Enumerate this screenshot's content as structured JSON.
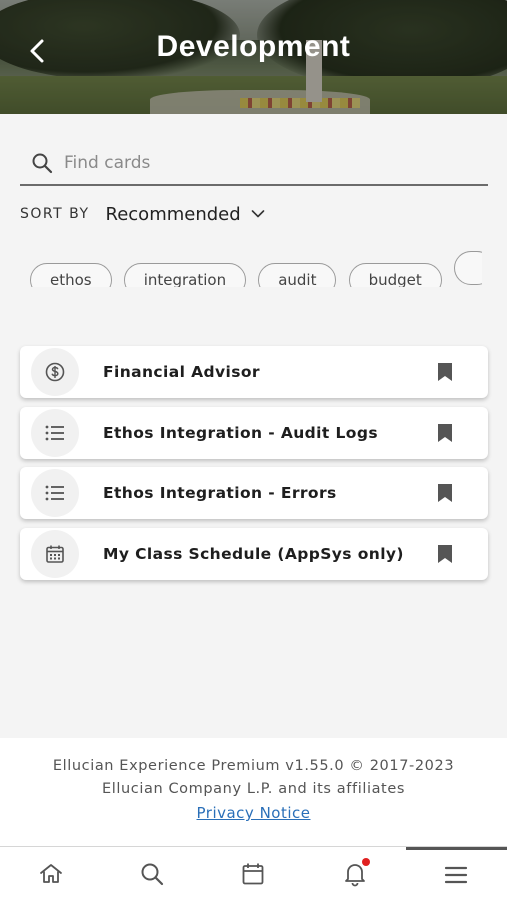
{
  "header": {
    "title": "Development",
    "back_icon": "chevron-left-icon"
  },
  "search": {
    "placeholder": "Find cards",
    "value": "",
    "icon": "search-icon"
  },
  "sort": {
    "label": "SORT BY",
    "value": "Recommended",
    "icon": "chevron-down-icon"
  },
  "chips": [
    {
      "label": "ethos"
    },
    {
      "label": "integration"
    },
    {
      "label": "audit"
    },
    {
      "label": "budget"
    }
  ],
  "cards": [
    {
      "title": "Financial Advisor",
      "icon": "dollar-circle-icon"
    },
    {
      "title": "Ethos Integration - Audit Logs",
      "icon": "list-icon"
    },
    {
      "title": "Ethos Integration - Errors",
      "icon": "list-icon"
    },
    {
      "title": "My Class Schedule (AppSys only)",
      "icon": "calendar-icon"
    }
  ],
  "footer": {
    "line1": "Ellucian Experience Premium v1.55.0 © 2017-2023",
    "line2": "Ellucian Company L.P. and its affiliates",
    "privacy_link": "Privacy Notice"
  },
  "nav": {
    "items": [
      "home-icon",
      "search-icon",
      "calendar-icon",
      "bell-icon",
      "menu-icon"
    ],
    "active": "menu-icon",
    "notification": true
  },
  "colors": {
    "link": "#2a6fb8",
    "notification_dot": "#e02020",
    "icon": "#555555"
  }
}
